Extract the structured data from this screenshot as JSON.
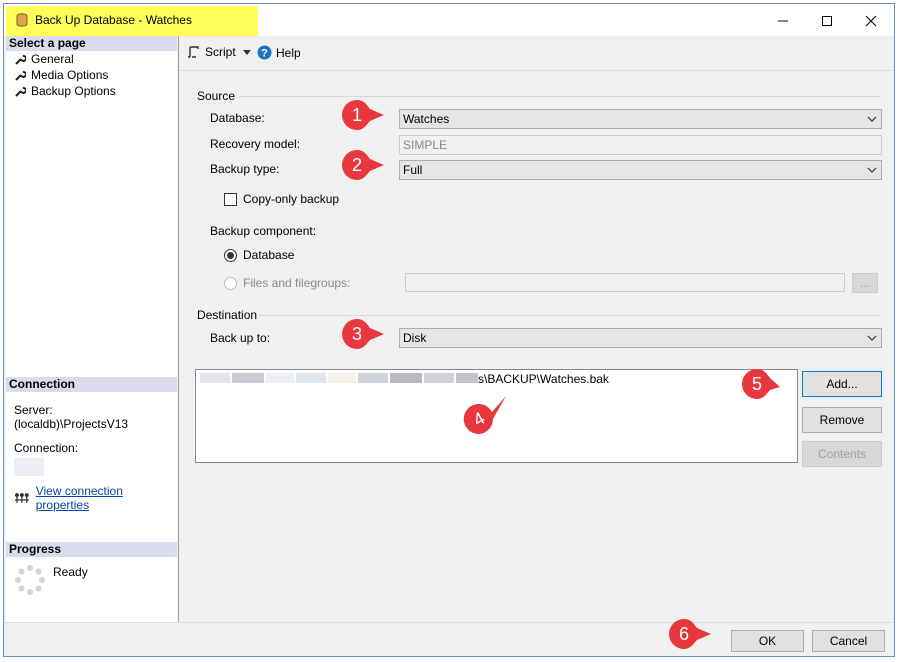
{
  "window": {
    "title": "Back Up Database - Watches"
  },
  "sidebar": {
    "select_page_heading": "Select a page",
    "pages": [
      {
        "label": "General"
      },
      {
        "label": "Media Options"
      },
      {
        "label": "Backup Options"
      }
    ],
    "connection": {
      "heading": "Connection",
      "server_label": "Server:",
      "server_value": "(localdb)\\ProjectsV13",
      "connection_label": "Connection:",
      "view_link": "View connection properties"
    },
    "progress": {
      "heading": "Progress",
      "status": "Ready"
    }
  },
  "toolbar": {
    "script_label": "Script",
    "help_label": "Help"
  },
  "source": {
    "heading": "Source",
    "database_label": "Database:",
    "database_value": "Watches",
    "recovery_label": "Recovery model:",
    "recovery_value": "SIMPLE",
    "backup_type_label": "Backup type:",
    "backup_type_value": "Full",
    "copy_only_label": "Copy-only backup",
    "component_label": "Backup component:",
    "component_database": "Database",
    "component_files": "Files and filegroups:"
  },
  "destination": {
    "heading": "Destination",
    "backup_to_label": "Back up to:",
    "backup_to_value": "Disk",
    "path_visible": "s\\BACKUP\\Watches.bak",
    "add_label": "Add...",
    "remove_label": "Remove",
    "contents_label": "Contents"
  },
  "footer": {
    "ok_label": "OK",
    "cancel_label": "Cancel"
  },
  "callouts": [
    "1",
    "2",
    "3",
    "4",
    "5",
    "6"
  ],
  "colors": {
    "callout": "#e8383d",
    "title_highlight": "#ffff5a",
    "focus_border": "#0078d7"
  }
}
